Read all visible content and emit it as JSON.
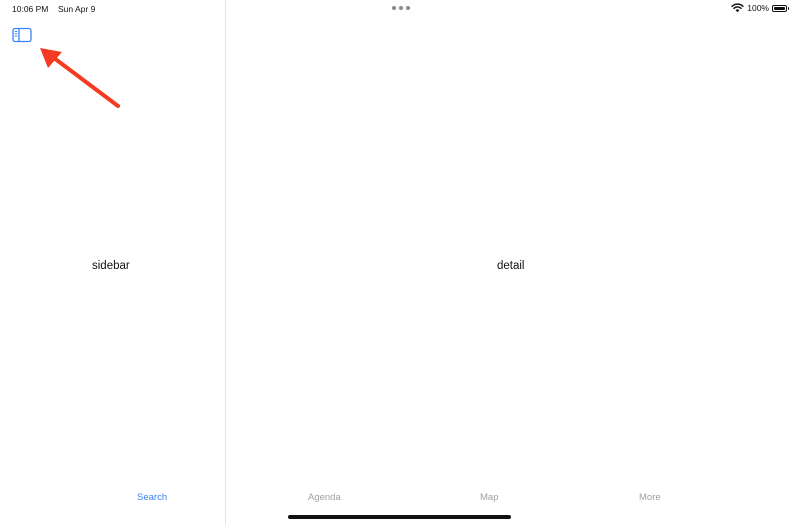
{
  "status_bar": {
    "time": "10:06 PM",
    "date": "Sun Apr 9",
    "battery_percent": "100%",
    "icons": [
      "wifi-icon",
      "battery-icon",
      "multitask-dots-icon"
    ]
  },
  "sidebar": {
    "toggle_icon": "sidebar-toggle-icon",
    "label": "sidebar"
  },
  "detail": {
    "label": "detail"
  },
  "tab_bar": {
    "items": [
      {
        "label": "Search",
        "active": true
      },
      {
        "label": "Agenda",
        "active": false
      },
      {
        "label": "Map",
        "active": false
      },
      {
        "label": "More",
        "active": false
      }
    ]
  },
  "annotation": {
    "type": "arrow",
    "color": "#f43b22",
    "points_to": "sidebar-toggle-button"
  },
  "colors": {
    "accent": "#3b82f6",
    "inactive_tab": "#a0a0a5",
    "divider": "#e4e4e7",
    "annotation": "#f43b22"
  }
}
